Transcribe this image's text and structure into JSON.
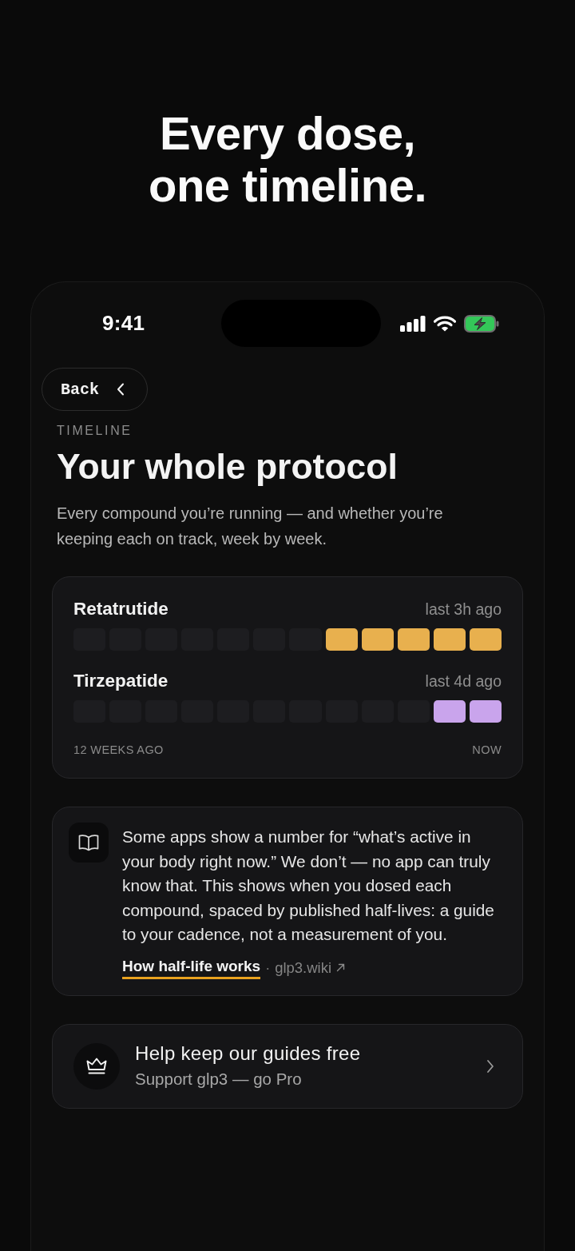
{
  "headline": "Every dose,\none timeline.",
  "status_bar": {
    "time": "9:41"
  },
  "back_button": {
    "label": "Back"
  },
  "eyebrow": "TIMELINE",
  "title": "Your whole protocol",
  "subtitle": "Every compound you’re running — and whether you’re keeping each on track, week by week.",
  "timeline": {
    "compounds": [
      {
        "name": "Retatrutide",
        "last_dose": "last 3h ago",
        "color": "#e8b04e",
        "weeks": [
          {
            "dosed": false
          },
          {
            "dosed": false
          },
          {
            "dosed": false
          },
          {
            "dosed": false
          },
          {
            "dosed": false
          },
          {
            "dosed": false
          },
          {
            "dosed": false
          },
          {
            "dosed": true
          },
          {
            "dosed": true
          },
          {
            "dosed": true
          },
          {
            "dosed": true
          },
          {
            "dosed": true
          }
        ]
      },
      {
        "name": "Tirzepatide",
        "last_dose": "last 4d ago",
        "color": "#c9a4ec",
        "weeks": [
          {
            "dosed": false
          },
          {
            "dosed": false
          },
          {
            "dosed": false
          },
          {
            "dosed": false
          },
          {
            "dosed": false
          },
          {
            "dosed": false
          },
          {
            "dosed": false
          },
          {
            "dosed": false
          },
          {
            "dosed": false
          },
          {
            "dosed": false
          },
          {
            "dosed": true
          },
          {
            "dosed": true
          }
        ]
      }
    ],
    "axis_start": "12 WEEKS AGO",
    "axis_end": "NOW"
  },
  "note": {
    "text": "Some apps show a number for “what’s active in your body right now.” We don’t — no app can truly know that. This shows when you dosed each compound, spaced by published half-lives: a guide to your cadence, not a measurement of you.",
    "link": "How half-life works",
    "separator": "·",
    "source": "glp3.wiki"
  },
  "support": {
    "title": "Help keep our guides free",
    "subtitle": "Support glp3 — go Pro"
  }
}
